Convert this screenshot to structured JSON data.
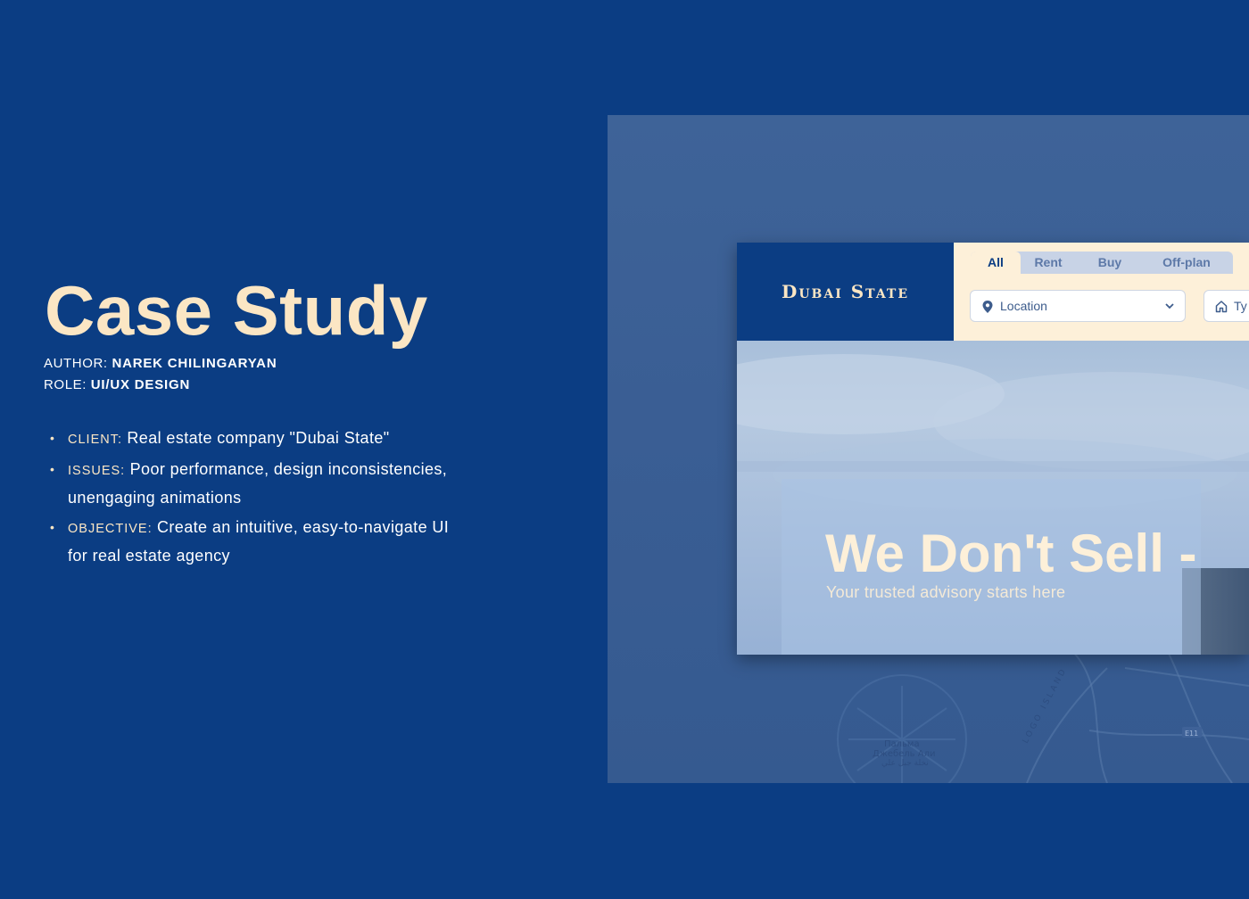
{
  "case_study": {
    "title": "Case Study",
    "author_label": "AUTHOR:",
    "author_value": "NAREK CHILINGARYAN",
    "role_label": "ROLE:",
    "role_value": "UI/UX DESIGN",
    "bullets": [
      {
        "key": "Client:",
        "value": "Real estate company \"Dubai State\""
      },
      {
        "key": "Issues:",
        "value": "Poor performance, design inconsistencies, unengaging animations"
      },
      {
        "key": "Objective:",
        "value": "Create an intuitive, easy-to-navigate UI for real estate agency"
      }
    ]
  },
  "mockup": {
    "brand": "Dubai State",
    "tabs": [
      "All",
      "Rent",
      "Buy",
      "Off-plan"
    ],
    "active_tab": "All",
    "location_select": "Location",
    "type_select": "Ty",
    "hero_title": "We Don't Sell -",
    "hero_subtitle": "Your trusted advisory starts here",
    "map_labels": {
      "palm_ru_1": "Пальма",
      "palm_ru_2": "Джебель Али",
      "palm_ar": "نخلة جبل علي",
      "island": "LOGO ISLAND",
      "road": "E11"
    }
  },
  "colors": {
    "background": "#0b3d83",
    "accent_cream": "#fbe6c4",
    "header_cream": "#fdf0d9"
  },
  "icons": [
    "pin-icon",
    "chevron-down-icon",
    "home-icon"
  ]
}
